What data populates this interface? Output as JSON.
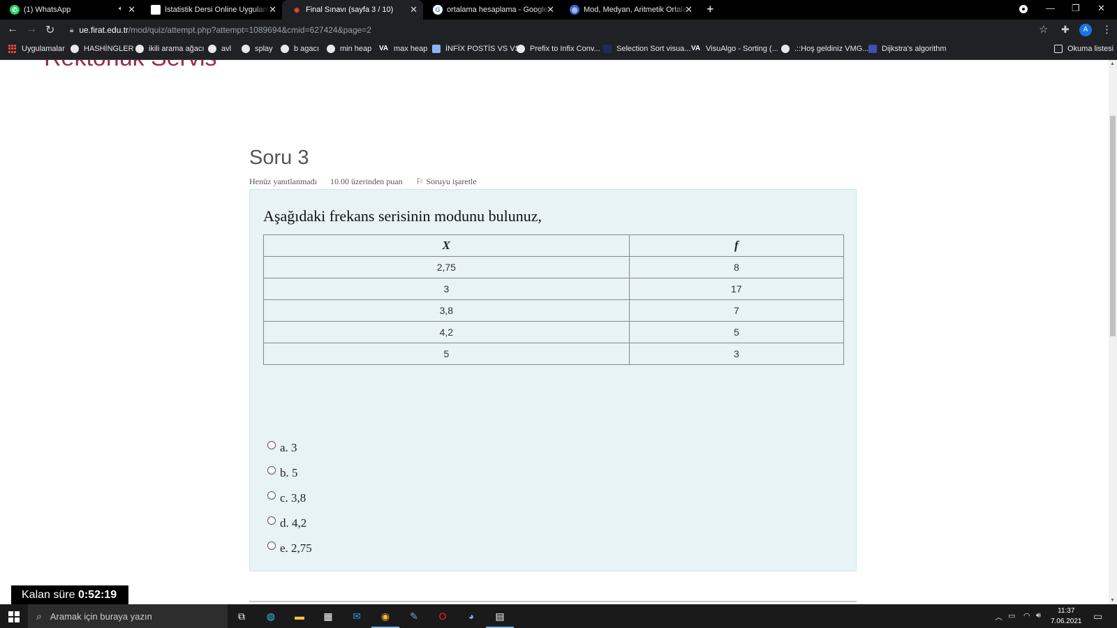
{
  "browser": {
    "tabs": [
      {
        "title": "(1) WhatsApp",
        "icon": "whatsapp-icon",
        "color": "#25d366"
      },
      {
        "title": "İstatistik Dersi Online Uygulama |",
        "icon": "sheets-icon",
        "color": "#34a853"
      },
      {
        "title": "Final Sınavı (sayfa 3 / 10)",
        "icon": "moodle-icon",
        "color": "#e94e2c"
      },
      {
        "title": "ortalama hesaplama - Google'da",
        "icon": "google-icon",
        "color": "#4285f4"
      },
      {
        "title": "Mod, Medyan, Aritmetik Ortalam",
        "icon": "site-icon",
        "color": "#3b6bd6"
      }
    ],
    "url_host": "ue.firat.edu.tr",
    "url_path": "/mod/quiz/attempt.php?attempt=1089694&cmid=627424&page=2",
    "avatar_letter": "A",
    "bookmarks": [
      "Uygulamalar",
      "HASHİNGLER",
      "ikili arama ağacı",
      "avl",
      "splay",
      "b agacı",
      "min heap",
      "max heap",
      "İNFİX POSTİS VS VS",
      "Prefix to Infix Conv...",
      "Selection Sort visua...",
      "VisuAlgo - Sorting (...",
      ".::Hoş geldiniz VMG...",
      "Dijkstra's algorithm"
    ],
    "reading_list": "Okuma listesi"
  },
  "page": {
    "site_title": "Rektörlük Servis",
    "question": {
      "title": "Soru 3",
      "status": "Henüz yanıtlanmadı",
      "points": "10.00 üzerinden puan",
      "flag": "Soruyu işaretle",
      "text": "Aşağıdaki frekans serisinin modunu bulunuz,",
      "table": {
        "headers": [
          "X",
          "f"
        ],
        "rows": [
          [
            "2,75",
            "8"
          ],
          [
            "3",
            "17"
          ],
          [
            "3,8",
            "7"
          ],
          [
            "4,2",
            "5"
          ],
          [
            "5",
            "3"
          ]
        ]
      },
      "options": [
        "a. 3",
        "b. 5",
        "c. 3,8",
        "d. 4,2",
        "e. 2,75"
      ]
    },
    "timer_label": "Kalan süre",
    "timer_value": "0:52:19"
  },
  "taskbar": {
    "search_placeholder": "Aramak için buraya yazın",
    "time": "11:37",
    "date": "7.06.2021"
  }
}
